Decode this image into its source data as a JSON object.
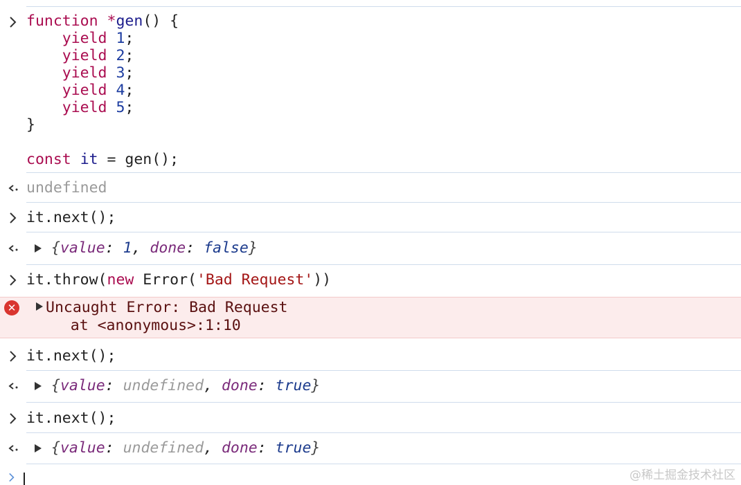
{
  "gutter": {
    "input_glyph": "❯",
    "output_glyph": "↩"
  },
  "entries": {
    "e1": {
      "lines": [
        "function *gen() {",
        "    yield 1;",
        "    yield 2;",
        "    yield 3;",
        "    yield 4;",
        "    yield 5;",
        "}",
        "",
        "const it = gen();"
      ],
      "result": "undefined"
    },
    "e2": {
      "input": "it.next();",
      "result": "{value: 1, done: false}"
    },
    "e3": {
      "input": "it.throw(new Error('Bad Request'))",
      "error_line1": "Uncaught Error: Bad Request",
      "error_line2": "    at <anonymous>:1:10"
    },
    "e4": {
      "input": "it.next();",
      "result": "{value: undefined, done: true}"
    },
    "e5": {
      "input": "it.next();",
      "result": "{value: undefined, done: true}"
    }
  },
  "watermark": "@稀土掘金技术社区",
  "colors": {
    "keyword": "#aa0d50",
    "number": "#1c3ca0",
    "string": "#a31515",
    "error_bg": "#fcecec",
    "separator": "#cfdcec"
  }
}
